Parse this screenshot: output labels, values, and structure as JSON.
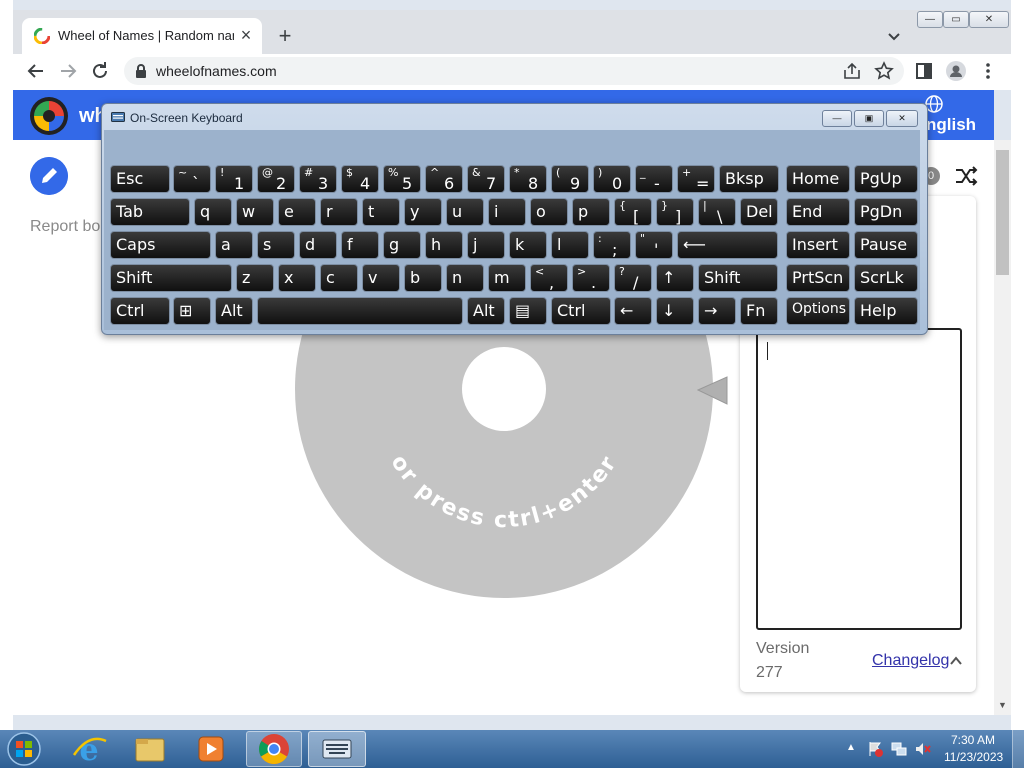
{
  "browser": {
    "tab_title": "Wheel of Names | Random name",
    "tab_close": "×",
    "new_tab": "+",
    "url": "wheelofnames.com",
    "window_controls": {
      "minimize": "—",
      "maximize": "▭",
      "close": "✕"
    }
  },
  "app": {
    "title": "wh",
    "language": "nglish",
    "report_text": "Report bo",
    "count_badge": "0",
    "wheel_text": "or press ctrl+enter",
    "version_label": "Version",
    "version_number": "277",
    "changelog_label": "Changelog",
    "brand_color": "#3369e8"
  },
  "osk": {
    "title": "On-Screen Keyboard",
    "rows": [
      [
        {
          "label": "Esc"
        },
        {
          "sup": "~",
          "sub": "`"
        },
        {
          "sup": "!",
          "sub": "1"
        },
        {
          "sup": "@",
          "sub": "2"
        },
        {
          "sup": "#",
          "sub": "3"
        },
        {
          "sup": "$",
          "sub": "4"
        },
        {
          "sup": "%",
          "sub": "5"
        },
        {
          "sup": "^",
          "sub": "6"
        },
        {
          "sup": "&",
          "sub": "7"
        },
        {
          "sup": "*",
          "sub": "8"
        },
        {
          "sup": "(",
          "sub": "9"
        },
        {
          "sup": ")",
          "sub": "0"
        },
        {
          "sup": "_",
          "sub": "-"
        },
        {
          "sup": "+",
          "sub": "="
        },
        {
          "label": "Bksp"
        },
        {
          "label": "Home"
        },
        {
          "label": "PgUp"
        }
      ],
      [
        {
          "label": "Tab"
        },
        {
          "label": "q"
        },
        {
          "label": "w"
        },
        {
          "label": "e"
        },
        {
          "label": "r"
        },
        {
          "label": "t"
        },
        {
          "label": "y"
        },
        {
          "label": "u"
        },
        {
          "label": "i"
        },
        {
          "label": "o"
        },
        {
          "label": "p"
        },
        {
          "sup": "{",
          "sub": "["
        },
        {
          "sup": "}",
          "sub": "]"
        },
        {
          "sup": "|",
          "sub": "\\"
        },
        {
          "label": "Del"
        },
        {
          "label": "End"
        },
        {
          "label": "PgDn"
        }
      ],
      [
        {
          "label": "Caps"
        },
        {
          "label": "a"
        },
        {
          "label": "s"
        },
        {
          "label": "d"
        },
        {
          "label": "f"
        },
        {
          "label": "g"
        },
        {
          "label": "h"
        },
        {
          "label": "j"
        },
        {
          "label": "k"
        },
        {
          "label": "l"
        },
        {
          "sup": ":",
          "sub": ";"
        },
        {
          "sup": "\"",
          "sub": "'"
        },
        {
          "label": "⟵"
        },
        {
          "label": "Insert"
        },
        {
          "label": "Pause"
        }
      ],
      [
        {
          "label": "Shift"
        },
        {
          "label": "z"
        },
        {
          "label": "x"
        },
        {
          "label": "c"
        },
        {
          "label": "v"
        },
        {
          "label": "b"
        },
        {
          "label": "n"
        },
        {
          "label": "m"
        },
        {
          "sup": "<",
          "sub": ","
        },
        {
          "sup": ">",
          "sub": "."
        },
        {
          "sup": "?",
          "sub": "/"
        },
        {
          "label": "↑"
        },
        {
          "label": "Shift"
        },
        {
          "label": "PrtScn"
        },
        {
          "label": "ScrLk"
        }
      ],
      [
        {
          "label": "Ctrl"
        },
        {
          "label": "⊞"
        },
        {
          "label": "Alt"
        },
        {
          "label": ""
        },
        {
          "label": "Alt"
        },
        {
          "label": "▤"
        },
        {
          "label": "Ctrl"
        },
        {
          "label": "←"
        },
        {
          "label": "↓"
        },
        {
          "label": "→"
        },
        {
          "label": "Fn"
        },
        {
          "label": "Options"
        },
        {
          "label": "Help"
        }
      ]
    ]
  },
  "taskbar": {
    "time": "7:30 AM",
    "date": "11/23/2023",
    "apps": [
      "internet-explorer-icon",
      "file-explorer-icon",
      "media-player-icon",
      "chrome-icon",
      "on-screen-keyboard-icon"
    ]
  }
}
